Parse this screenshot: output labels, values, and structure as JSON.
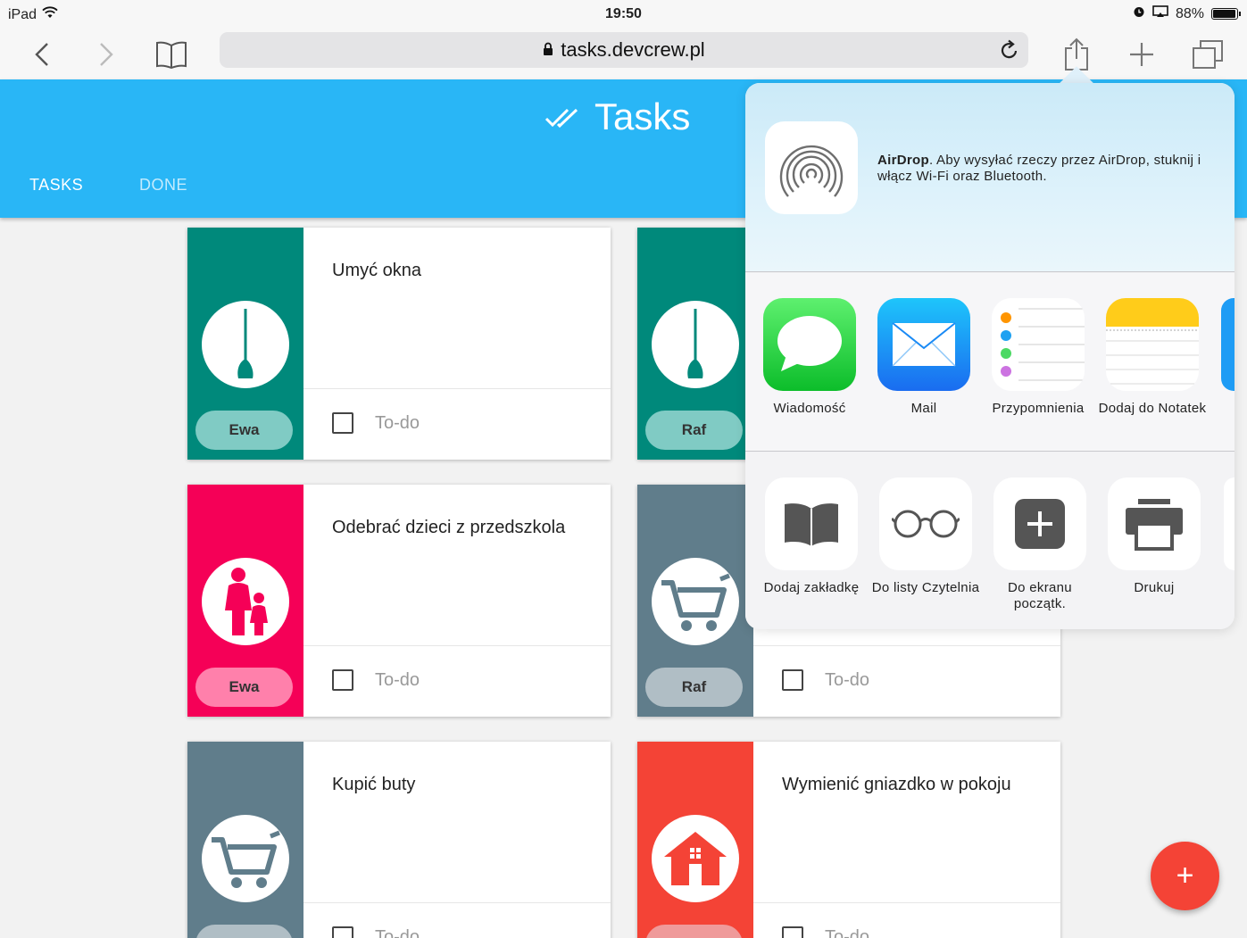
{
  "status_bar": {
    "device": "iPad",
    "time": "19:50",
    "battery": "88%",
    "battery_level": 0.88
  },
  "browser": {
    "url": "tasks.devcrew.pl"
  },
  "app": {
    "title": "Tasks",
    "tabs": [
      {
        "label": "TASKS",
        "active": true
      },
      {
        "label": "DONE",
        "active": false
      }
    ]
  },
  "tasks": [
    {
      "title": "Umyć okna",
      "person": "Ewa",
      "status": "To-do",
      "color": "#00897b",
      "badge_color": "#80cbc4",
      "icon": "broom-icon"
    },
    {
      "title": "",
      "person": "Raf",
      "status": "",
      "color": "#00897b",
      "badge_color": "#80cbc4",
      "icon": "broom-icon"
    },
    {
      "title": "Odebrać dzieci z przedszkola",
      "person": "Ewa",
      "status": "To-do",
      "color": "#f50057",
      "badge_color": "#ff80ab",
      "icon": "family-icon"
    },
    {
      "title": "",
      "person": "Raf",
      "status": "To-do",
      "color": "#607d8b",
      "badge_color": "#b0bec5",
      "icon": "cart-icon"
    },
    {
      "title": "Kupić buty",
      "person": "",
      "status": "To-do",
      "color": "#607d8b",
      "badge_color": "#b0bec5",
      "icon": "cart-icon"
    },
    {
      "title": "Wymienić gniazdko w pokoju",
      "person": "",
      "status": "To-do",
      "color": "#f44336",
      "badge_color": "#ef9a9a",
      "icon": "house-icon"
    }
  ],
  "fab": {
    "label": "+"
  },
  "share_sheet": {
    "airdrop_title": "AirDrop",
    "airdrop_text": ". Aby wysyłać rzeczy przez AirDrop, stuknij i włącz Wi-Fi oraz Bluetooth.",
    "apps": [
      {
        "label": "Wiadomość",
        "icon": "messages-icon"
      },
      {
        "label": "Mail",
        "icon": "mail-icon"
      },
      {
        "label": "Przypomnienia",
        "icon": "reminders-icon"
      },
      {
        "label": "Dodaj do Notatek",
        "icon": "notes-icon"
      }
    ],
    "actions": [
      {
        "label": "Dodaj zakładkę",
        "icon": "bookmark-book-icon"
      },
      {
        "label": "Do listy Czytelnia",
        "icon": "reading-glasses-icon"
      },
      {
        "label": "Do ekranu początk.",
        "icon": "add-square-icon"
      },
      {
        "label": "Drukuj",
        "icon": "printer-icon"
      }
    ]
  }
}
